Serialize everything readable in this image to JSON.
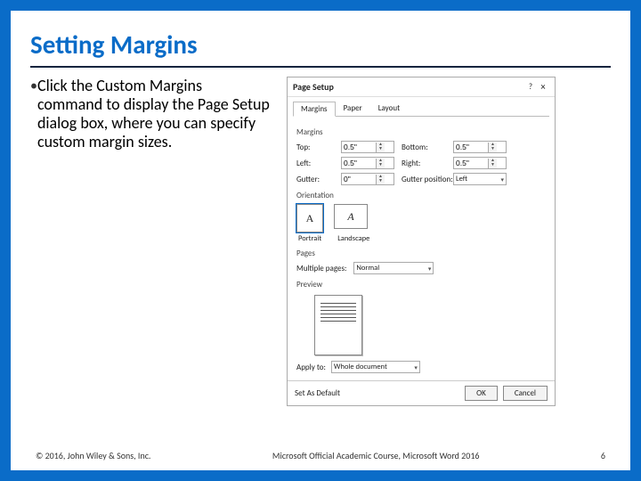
{
  "slide": {
    "title": "Setting Margins",
    "bullet": "Click the Custom Margins command to display the Page Setup dialog box, where you can specify custom margin sizes."
  },
  "dialog": {
    "title": "Page Setup",
    "help": "?",
    "close": "×",
    "tabs": {
      "margins": "Margins",
      "paper": "Paper",
      "layout": "Layout"
    },
    "sections": {
      "margins": "Margins",
      "orientation": "Orientation",
      "pages": "Pages",
      "preview": "Preview"
    },
    "fields": {
      "top_label": "Top:",
      "top_value": "0.5\"",
      "bottom_label": "Bottom:",
      "bottom_value": "0.5\"",
      "left_label": "Left:",
      "left_value": "0.5\"",
      "right_label": "Right:",
      "right_value": "0.5\"",
      "gutter_label": "Gutter:",
      "gutter_value": "0\"",
      "gutterpos_label": "Gutter position:",
      "gutterpos_value": "Left"
    },
    "orientation": {
      "portrait_glyph": "A",
      "landscape_glyph": "A",
      "portrait_label": "Portrait",
      "landscape_label": "Landscape"
    },
    "pages": {
      "label": "Multiple pages:",
      "value": "Normal"
    },
    "apply": {
      "label": "Apply to:",
      "value": "Whole document"
    },
    "buttons": {
      "default": "Set As Default",
      "ok": "OK",
      "cancel": "Cancel"
    }
  },
  "footer": {
    "copyright": "© 2016, John Wiley & Sons, Inc.",
    "course": "Microsoft Official Academic Course, Microsoft Word 2016",
    "page": "6"
  }
}
